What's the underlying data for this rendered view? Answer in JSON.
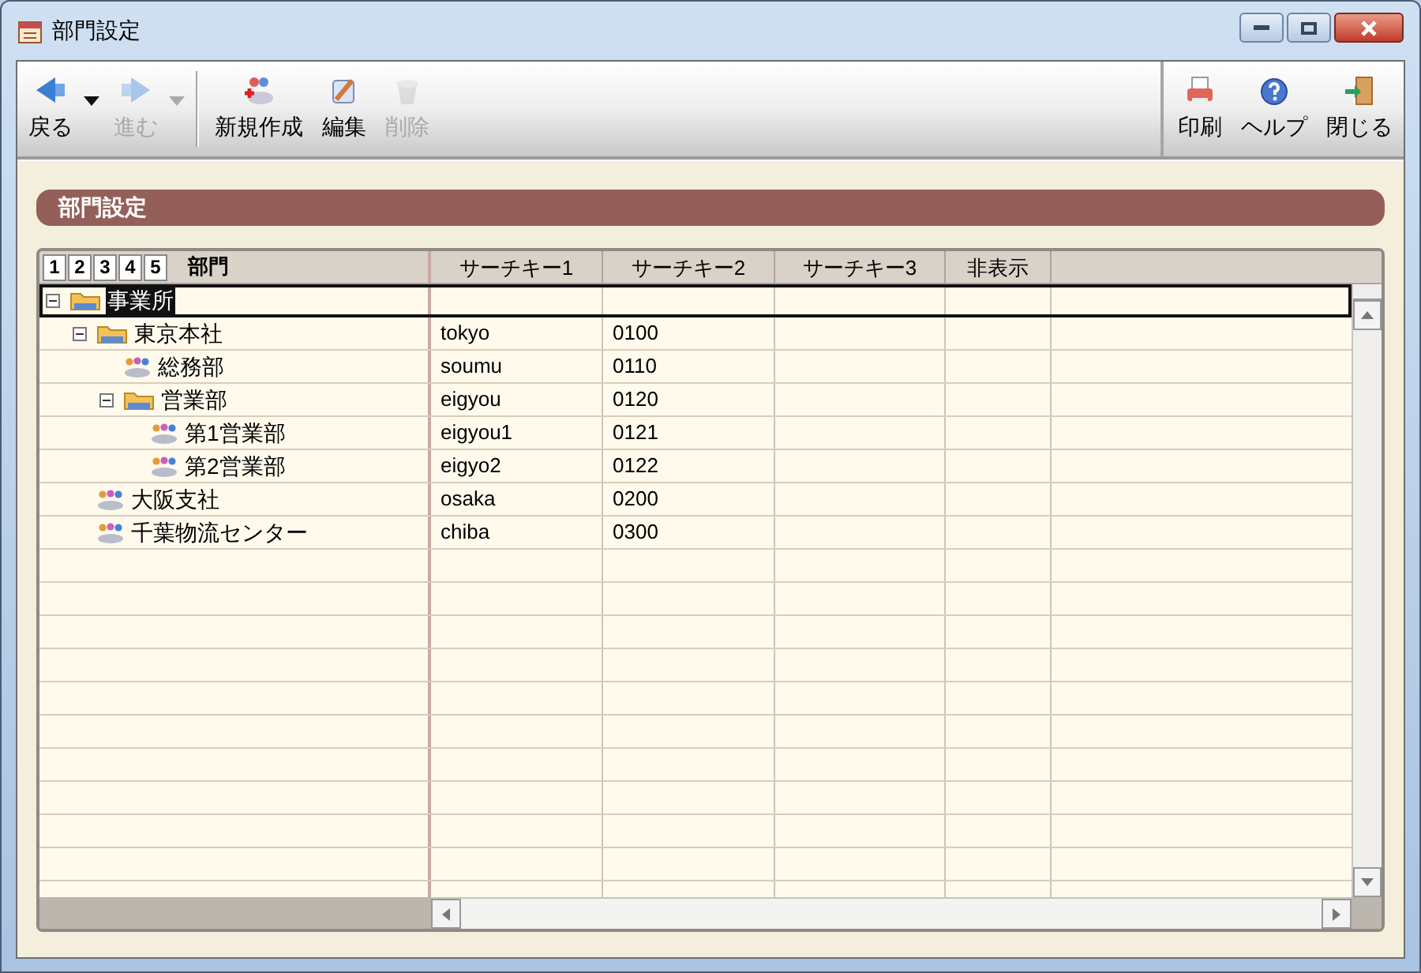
{
  "window": {
    "title": "部門設定"
  },
  "toolbar": {
    "left": [
      {
        "kind": "back",
        "label": "戻る",
        "disabled": false,
        "dropdown": true
      },
      {
        "kind": "forward",
        "label": "進む",
        "disabled": true,
        "dropdown": true
      },
      {
        "kind": "new",
        "label": "新規作成",
        "disabled": false,
        "dropdown": false,
        "separator_before": true
      },
      {
        "kind": "edit",
        "label": "編集",
        "disabled": false,
        "dropdown": false
      },
      {
        "kind": "delete",
        "label": "削除",
        "disabled": true,
        "dropdown": false
      }
    ],
    "right": [
      {
        "kind": "print",
        "label": "印刷",
        "disabled": false,
        "dropdown": false
      },
      {
        "kind": "help",
        "label": "ヘルプ",
        "disabled": false,
        "dropdown": false
      },
      {
        "kind": "close",
        "label": "閉じる",
        "disabled": false,
        "dropdown": false
      }
    ]
  },
  "panel": {
    "title": "部門設定"
  },
  "grid": {
    "level_buttons": [
      "1",
      "2",
      "3",
      "4",
      "5"
    ],
    "tree_header": "部門",
    "columns": [
      "サーチキー1",
      "サーチキー2",
      "サーチキー3",
      "非表示"
    ],
    "tree": [
      {
        "label": "事業所",
        "selected": true,
        "expanded": true,
        "children": [
          {
            "label": "東京本社",
            "selected": false,
            "expanded": true,
            "cells": [
              "tokyo",
              "0100"
            ],
            "children": [
              {
                "label": "総務部",
                "selected": false,
                "cells": [
                  "soumu",
                  "0110"
                ]
              },
              {
                "label": "営業部",
                "selected": false,
                "expanded": true,
                "cells": [
                  "eigyou",
                  "0120"
                ],
                "children": [
                  {
                    "label": "第1営業部",
                    "selected": false,
                    "cells": [
                      "eigyou1",
                      "0121"
                    ]
                  },
                  {
                    "label": "第2営業部",
                    "selected": false,
                    "cells": [
                      "eigyo2",
                      "0122"
                    ]
                  }
                ]
              }
            ]
          },
          {
            "label": "大阪支社",
            "selected": false,
            "cells": [
              "osaka",
              "0200"
            ]
          },
          {
            "label": "千葉物流センター",
            "selected": false,
            "cells": [
              "chiba",
              "0300"
            ]
          }
        ]
      }
    ]
  }
}
